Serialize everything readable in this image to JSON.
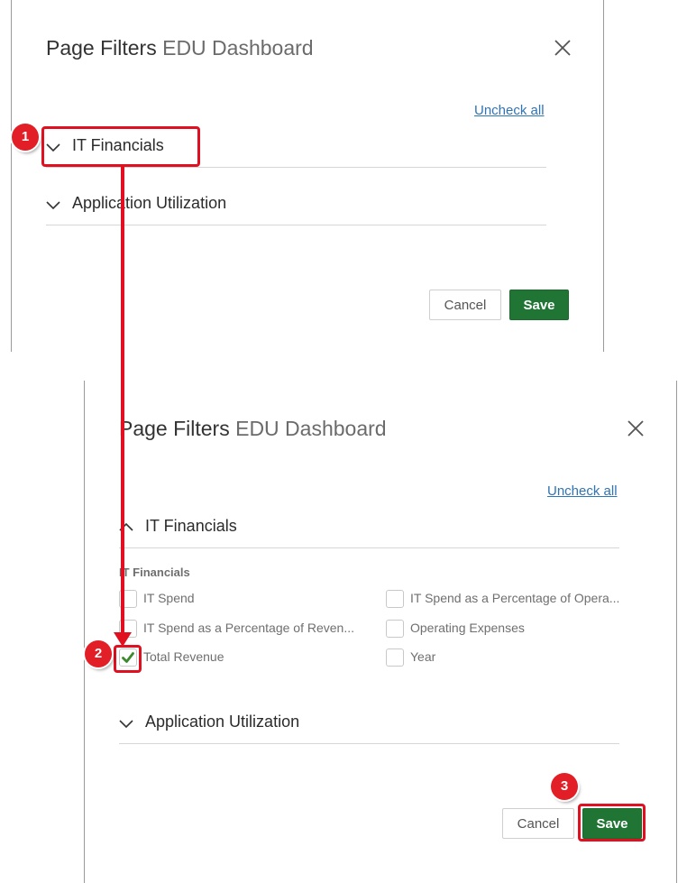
{
  "dialog_1": {
    "title": "Page Filters",
    "subtitle": "EDU Dashboard",
    "uncheck_all": "Uncheck all",
    "sections": [
      {
        "label": "IT Financials",
        "expanded": false
      },
      {
        "label": "Application Utilization",
        "expanded": false
      }
    ],
    "cancel_label": "Cancel",
    "save_label": "Save"
  },
  "dialog_2": {
    "title": "Page Filters",
    "subtitle": "EDU Dashboard",
    "uncheck_all": "Uncheck all",
    "section_it": {
      "label": "IT Financials",
      "expanded": true
    },
    "group_label": "IT Financials",
    "options": [
      {
        "label": "IT Spend",
        "checked": false
      },
      {
        "label": "IT Spend as a Percentage of Opera...",
        "checked": false
      },
      {
        "label": "IT Spend as a Percentage of Reven...",
        "checked": false
      },
      {
        "label": "Operating Expenses",
        "checked": false
      },
      {
        "label": "Total Revenue",
        "checked": true
      },
      {
        "label": "Year",
        "checked": false
      }
    ],
    "section_app": {
      "label": "Application Utilization",
      "expanded": false
    },
    "cancel_label": "Cancel",
    "save_label": "Save"
  },
  "callouts": {
    "step1": "1",
    "step2": "2",
    "step3": "3",
    "highlight_color": "#e01020",
    "badge_color": "#e21e26"
  },
  "colors": {
    "save_green": "#207535",
    "link_blue": "#2f74b5",
    "check_green": "#3a8a2c"
  },
  "icons": {
    "close": "close-icon",
    "chevron_down": "chevron-down-icon",
    "chevron_up": "chevron-up-icon",
    "checkmark": "checkmark-icon"
  }
}
